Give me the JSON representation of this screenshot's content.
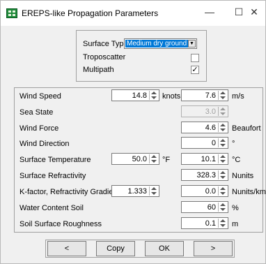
{
  "window": {
    "title": "EREPS-like Propagation Parameters",
    "minimize": "—",
    "maximize": "☐",
    "close": "✕"
  },
  "surface": {
    "label": "Surface Type",
    "selected": "Medium dry ground",
    "troposcatter_label": "Troposcatter",
    "troposcatter_checked": false,
    "multipath_label": "Multipath",
    "multipath_checked": true,
    "multipath_mark": "✓"
  },
  "params": {
    "wind_speed": {
      "label": "Wind Speed",
      "value1": "14.8",
      "unit1": "knots",
      "value2": "7.6",
      "unit2": "m/s"
    },
    "sea_state": {
      "label": "Sea State",
      "value2": "3.0"
    },
    "wind_force": {
      "label": "Wind Force",
      "value2": "4.6",
      "unit2": "Beaufort"
    },
    "wind_direction": {
      "label": "Wind Direction",
      "value2": "0",
      "unit2": "°"
    },
    "surface_temperature": {
      "label": "Surface Temperature",
      "value1": "50.0",
      "unit1": "°F",
      "value2": "10.1",
      "unit2": "°C"
    },
    "surface_refractivity": {
      "label": "Surface Refractivity",
      "value2": "328.3",
      "unit2": "Nunits"
    },
    "k_factor": {
      "label": "K-factor, Refractivity Gradient",
      "value1": "1.333",
      "value2": "0.0",
      "unit2": "Nunits/km"
    },
    "water_content": {
      "label": "Water Content Soil",
      "value2": "60",
      "unit2": "%"
    },
    "soil_roughness": {
      "label": "Soil Surface Roughness",
      "value2": "0.1",
      "unit2": "m"
    }
  },
  "buttons": {
    "prev": "<",
    "copy": "Copy",
    "ok": "OK",
    "next": ">"
  }
}
